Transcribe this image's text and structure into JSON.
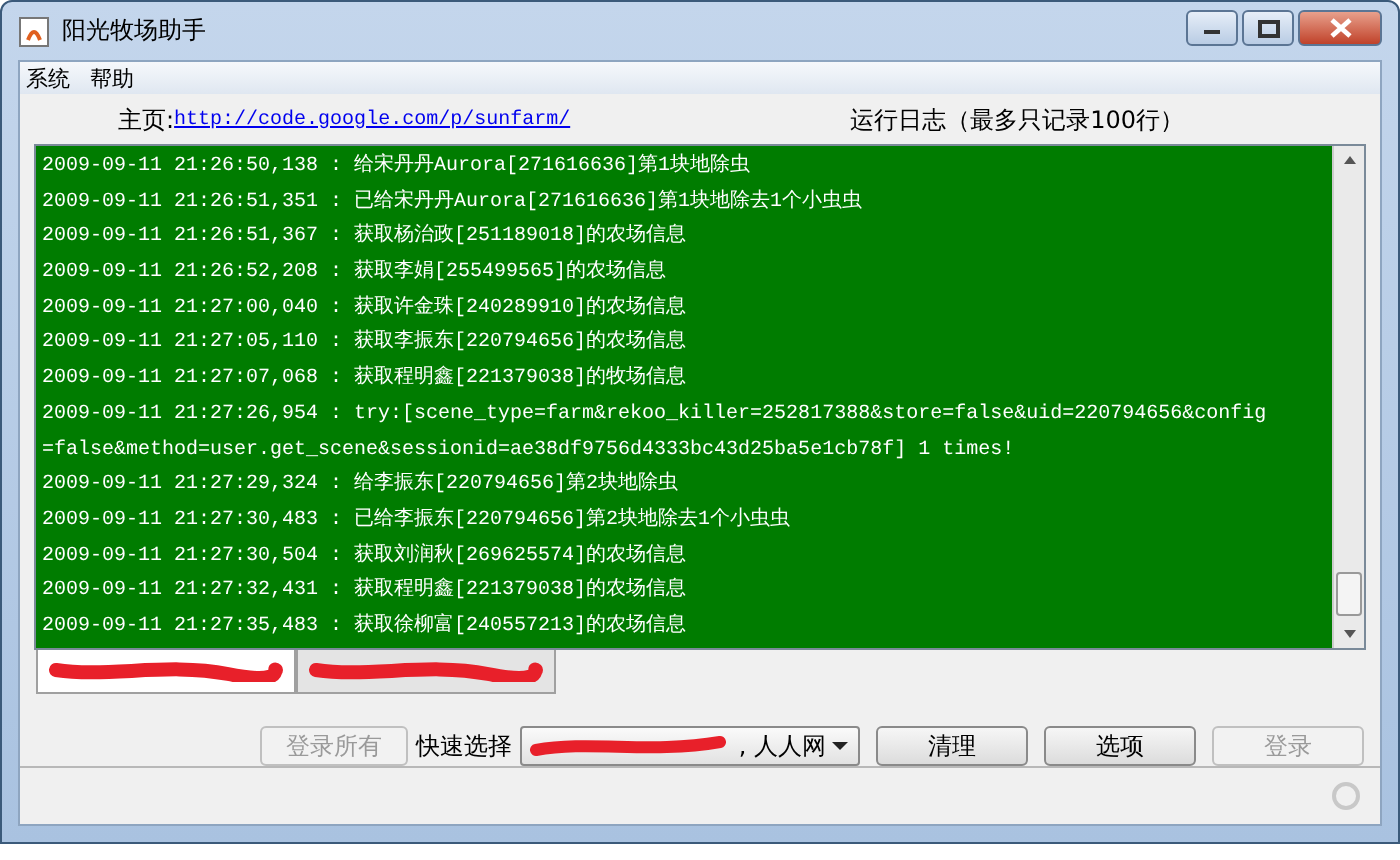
{
  "window": {
    "title": "阳光牧场助手"
  },
  "menu": [
    {
      "label": "系统"
    },
    {
      "label": "帮助"
    }
  ],
  "header": {
    "homepage_label": "主页:",
    "homepage_link": "http://code.google.com/p/sunfarm/",
    "log_title": "运行日志（最多只记录100行）"
  },
  "log_lines": [
    "2009-09-11 21:26:50,138 : 给宋丹丹Aurora[271616636]第1块地除虫",
    "2009-09-11 21:26:51,351 : 已给宋丹丹Aurora[271616636]第1块地除去1个小虫虫",
    "2009-09-11 21:26:51,367 : 获取杨治政[251189018]的农场信息",
    "2009-09-11 21:26:52,208 : 获取李娟[255499565]的农场信息",
    "2009-09-11 21:27:00,040 : 获取许金珠[240289910]的农场信息",
    "2009-09-11 21:27:05,110 : 获取李振东[220794656]的农场信息",
    "2009-09-11 21:27:07,068 : 获取程明鑫[221379038]的牧场信息",
    "2009-09-11 21:27:26,954 : try:[scene_type=farm&rekoo_killer=252817388&store=false&uid=220794656&config",
    "=false&method=user.get_scene&sessionid=ae38df9756d4333bc43d25ba5e1cb78f] 1 times!",
    "2009-09-11 21:27:29,324 : 给李振东[220794656]第2块地除虫",
    "2009-09-11 21:27:30,483 : 已给李振东[220794656]第2块地除去1个小虫虫",
    "2009-09-11 21:27:30,504 : 获取刘润秋[269625574]的农场信息",
    "2009-09-11 21:27:32,431 : 获取程明鑫[221379038]的农场信息",
    "2009-09-11 21:27:35,483 : 获取徐柳富[240557213]的农场信息"
  ],
  "account_tabs": [
    {
      "selected": true
    },
    {
      "selected": false
    }
  ],
  "controls": {
    "quick_select_label": "快速选择",
    "quick_select_value": ", 人人网"
  },
  "buttons": [
    {
      "kind": "button",
      "label": "登录所有",
      "disabled": true
    },
    {
      "kind": "dropdown"
    },
    {
      "kind": "button",
      "label": "清理",
      "disabled": false
    },
    {
      "kind": "button",
      "label": "选项",
      "disabled": false
    },
    {
      "kind": "button",
      "label": "登录",
      "disabled": true
    }
  ]
}
